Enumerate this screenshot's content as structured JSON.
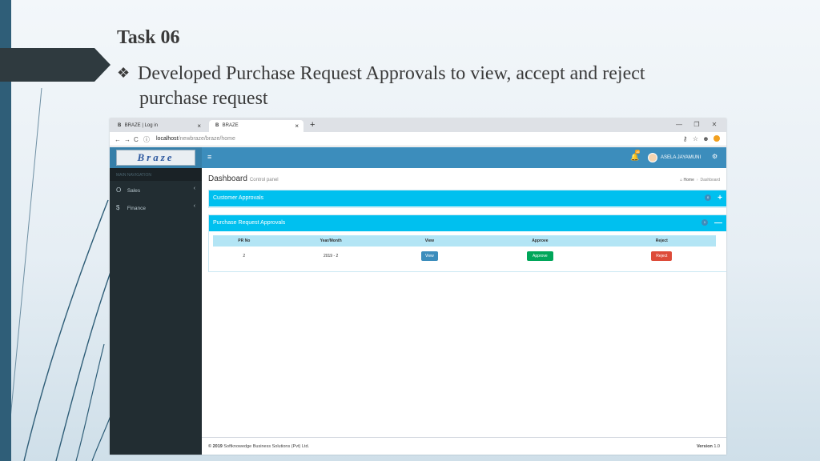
{
  "slide": {
    "title": "Task 06",
    "bullet_mark": "❖",
    "bullet_line1": "Developed Purchase Request Approvals to view, accept and reject",
    "bullet_line2": "purchase request"
  },
  "browser": {
    "tabs": [
      {
        "icon": "B",
        "label": "BRAZE | Log in",
        "close": "×"
      },
      {
        "icon": "B",
        "label": "BRAZE",
        "close": "×"
      }
    ],
    "new_tab": "+",
    "window_controls": [
      "—",
      "❐",
      "✕"
    ],
    "nav": {
      "back": "←",
      "forward": "→",
      "reload": "C",
      "info": "ⓘ"
    },
    "url_host": "localhost",
    "url_path": "/newbraze/braze/home",
    "addr_icons": {
      "key": "⚷",
      "star": "☆",
      "account": "☻"
    }
  },
  "app": {
    "logo_text": "Braze",
    "sidebar_header": "MAIN NAVIGATION",
    "sidebar_items": [
      {
        "icon": "O",
        "label": "Sales",
        "caret": "‹"
      },
      {
        "icon": "$",
        "label": "Finance",
        "caret": "‹"
      }
    ],
    "topnav": {
      "menu_icon": "≡",
      "bell_icon": "🔔",
      "bell_count": "16",
      "user_name": "ASELA JAYAMUNI",
      "settings_icon": "⚙"
    },
    "header": {
      "title": "Dashboard",
      "subtitle": "Control panel",
      "crumb_home_icon": "⌂",
      "crumb_home": "Home",
      "crumb_sep": "›",
      "crumb_current": "Dashboard"
    },
    "customer_box": {
      "title": "Customer Approvals",
      "count": "0",
      "toggle": "+"
    },
    "purchase_box": {
      "title": "Purchase Request Approvals",
      "count": "1",
      "toggle": "—",
      "columns": [
        "PR No",
        "Year/Month",
        "View",
        "Approve",
        "Reject"
      ],
      "rows": [
        {
          "pr_no": "2",
          "year_month": "2019 - 2",
          "view": "View",
          "approve": "Approve",
          "reject": "Reject"
        }
      ]
    },
    "footer": {
      "copyright": "© 2019",
      "company": "Softknowedge Business Solutions (Pvt) Ltd.",
      "version_label": "Version",
      "version_value": "1.0"
    }
  },
  "colors": {
    "topnav": "#3c8dbc",
    "box_header": "#00c0ef",
    "sidebar": "#222d32",
    "approve": "#00a65a",
    "reject": "#dd4b39"
  }
}
